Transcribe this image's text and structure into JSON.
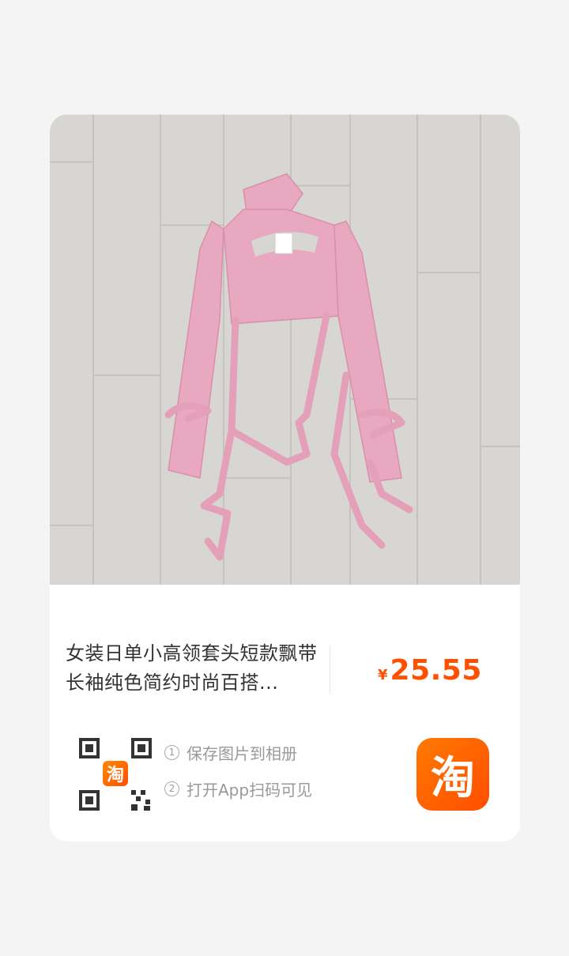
{
  "product": {
    "title": "女装日单小高领套头短款飘带长袖纯色简约时尚百搭...",
    "price_symbol": "¥",
    "price": "25.55",
    "image_alt": "Pink ribbed cropped long-sleeve top with ribbon ties on a wooden floor"
  },
  "qr": {
    "logo_char": "淘"
  },
  "steps": [
    {
      "num": "1",
      "text": "保存图片到相册"
    },
    {
      "num": "2",
      "text": "打开App扫码可见"
    }
  ],
  "app_icon": {
    "char": "淘",
    "name": "taobao-app-icon"
  },
  "colors": {
    "accent": "#ff5000",
    "background": "#f4f4f4",
    "card": "#ffffff",
    "garment": "#e8a9c0"
  }
}
